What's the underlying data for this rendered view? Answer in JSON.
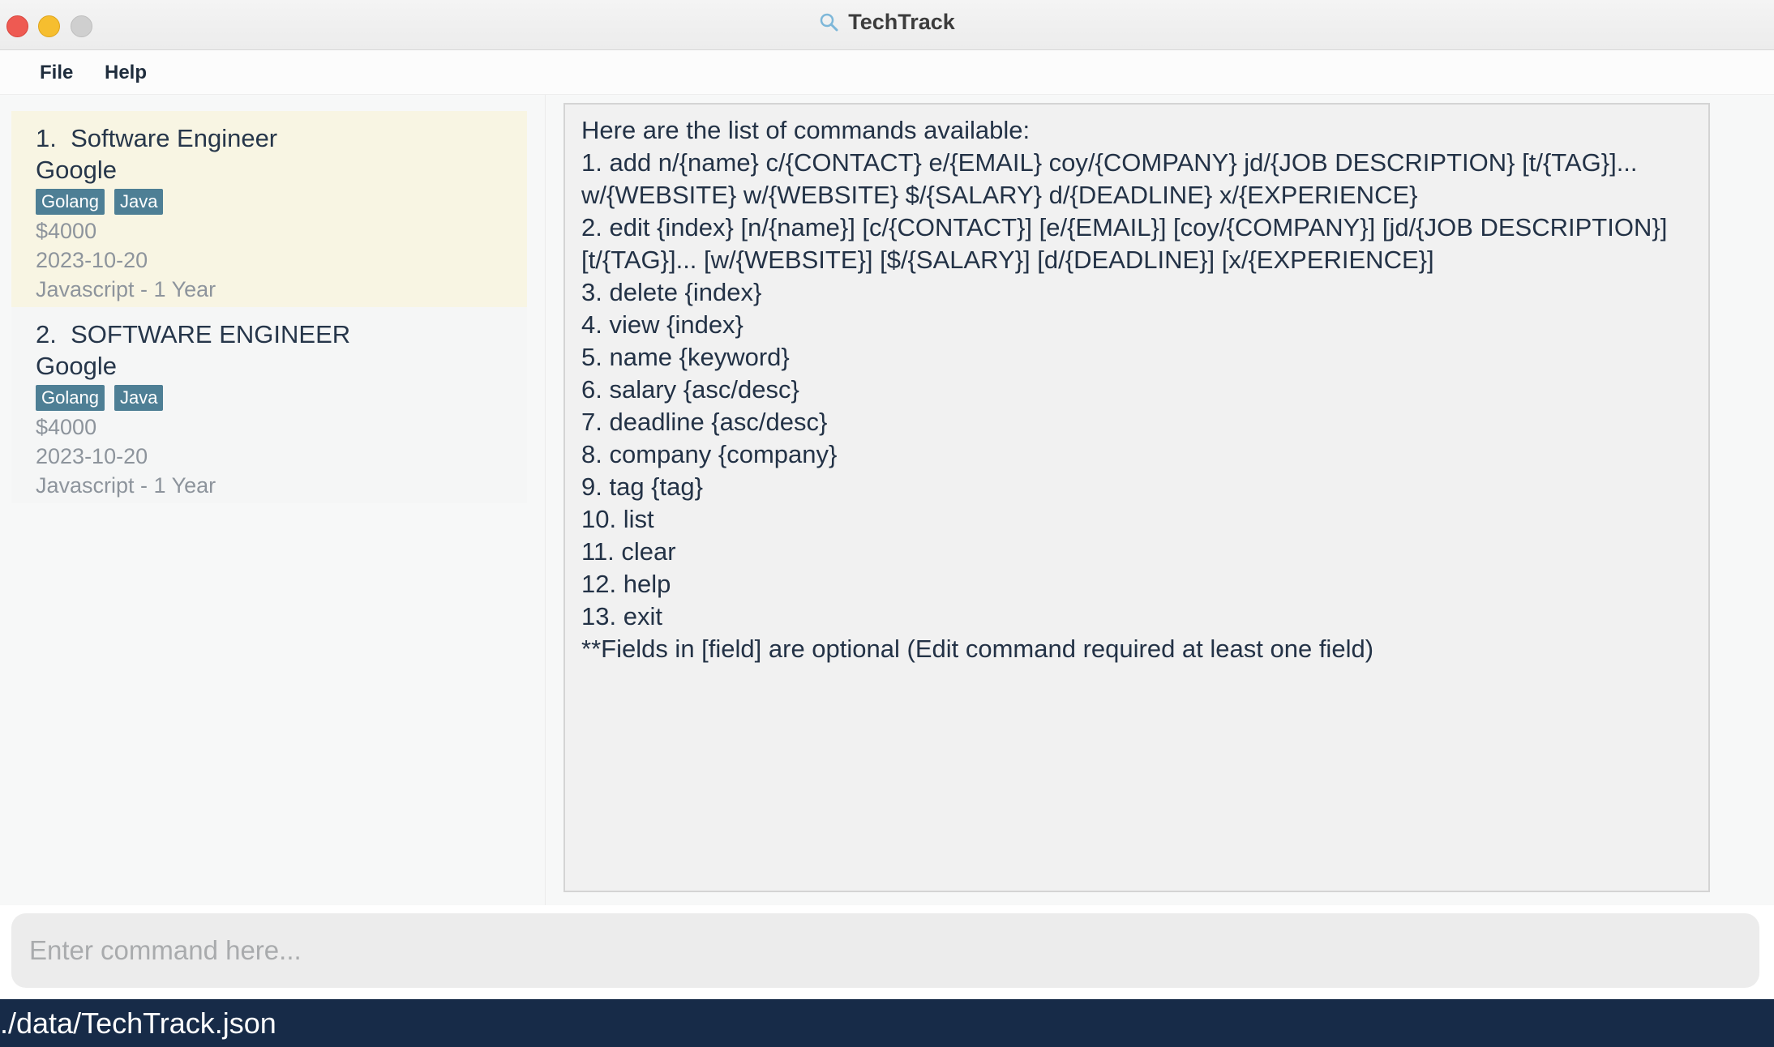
{
  "window": {
    "title": "TechTrack"
  },
  "menu": {
    "file": "File",
    "help": "Help"
  },
  "cards": [
    {
      "index": "1.",
      "position": "Software Engineer",
      "company": "Google",
      "tags": [
        "Golang",
        "Java"
      ],
      "salary": "$4000",
      "deadline": "2023-10-20",
      "experience": "Javascript - 1 Year"
    },
    {
      "index": "2.",
      "position": "SOFTWARE ENGINEER",
      "company": "Google",
      "tags": [
        "Golang",
        "Java"
      ],
      "salary": "$4000",
      "deadline": "2023-10-20",
      "experience": "Javascript - 1 Year"
    }
  ],
  "result": {
    "text": "Here are the list of commands available:\n1. add n/{name} c/{CONTACT} e/{EMAIL} coy/{COMPANY} jd/{JOB DESCRIPTION} [t/{TAG}]...\nw/{WEBSITE} w/{WEBSITE} $/{SALARY} d/{DEADLINE} x/{EXPERIENCE}\n2. edit {index} [n/{name}] [c/{CONTACT}] [e/{EMAIL}] [coy/{COMPANY}] [jd/{JOB DESCRIPTION}]\n[t/{TAG}]... [w/{WEBSITE}] [$/{SALARY}] [d/{DEADLINE}] [x/{EXPERIENCE}]\n3. delete {index}\n4. view {index}\n5. name {keyword}\n6. salary {asc/desc}\n7. deadline {asc/desc}\n8. company {company}\n9. tag {tag}\n10. list\n11. clear\n12. help\n13. exit\n**Fields in [field] are optional (Edit command required at least one field)"
  },
  "command": {
    "placeholder": "Enter command here...",
    "value": ""
  },
  "status": {
    "path": "./data/TechTrack.json"
  }
}
